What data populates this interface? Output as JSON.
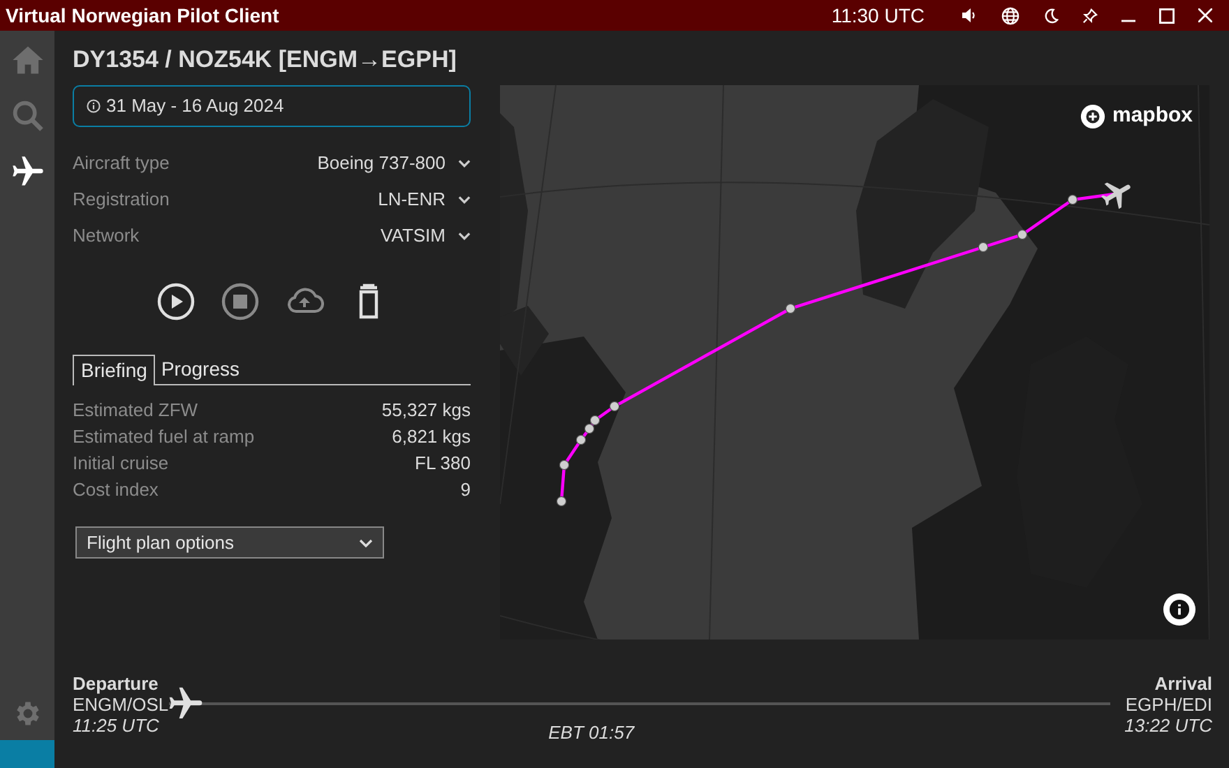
{
  "window": {
    "title": "Virtual Norwegian Pilot Client",
    "clock": "11:30 UTC"
  },
  "sidebar": {
    "items": [
      {
        "kind": "home",
        "selected": false
      },
      {
        "kind": "search",
        "selected": false
      },
      {
        "kind": "flight",
        "selected": true
      }
    ]
  },
  "flight": {
    "title": "DY1354 / NOZ54K [ENGM→EGPH]",
    "validity": "31 May - 16 Aug 2024"
  },
  "settings": [
    {
      "label": "Aircraft type",
      "value": "Boeing 737-800"
    },
    {
      "label": "Registration",
      "value": "LN-ENR"
    },
    {
      "label": "Network",
      "value": "VATSIM"
    }
  ],
  "actions": [
    {
      "kind": "play",
      "disabled": false
    },
    {
      "kind": "stop",
      "disabled": true
    },
    {
      "kind": "upload",
      "disabled": true
    },
    {
      "kind": "delete",
      "disabled": false
    }
  ],
  "tabs": [
    {
      "label": "Briefing",
      "selected": true
    },
    {
      "label": "Progress",
      "selected": false
    }
  ],
  "briefing": [
    {
      "label": "Estimated ZFW",
      "value": "55,327 kgs"
    },
    {
      "label": "Estimated fuel at ramp",
      "value": "6,821 kgs"
    },
    {
      "label": "Initial cruise",
      "value": "FL 380"
    },
    {
      "label": "Cost index",
      "value": "9"
    }
  ],
  "flight_plan_select": {
    "value": "Flight plan options"
  },
  "map": {
    "kind": "picture",
    "attribution": "mapbox"
  },
  "timeline": {
    "departure": {
      "label": "Departure",
      "airport": "ENGM/OSL",
      "time": "11:25 UTC"
    },
    "arrival": {
      "label": "Arrival",
      "airport": "EGPH/EDI",
      "time": "13:22 UTC"
    },
    "ebt": "EBT 01:57",
    "level": 0.0
  }
}
